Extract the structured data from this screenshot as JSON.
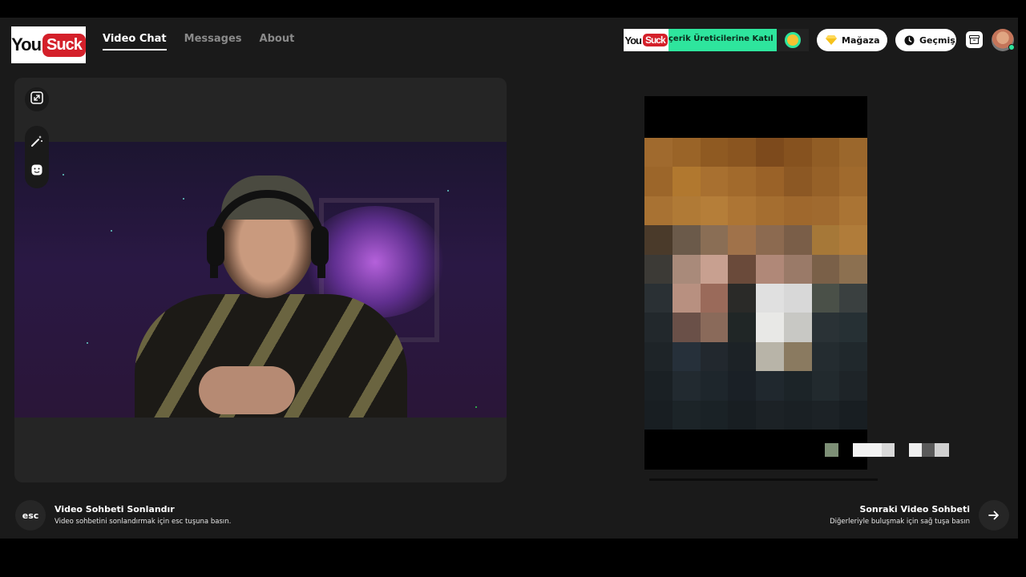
{
  "brand": {
    "logo_part1": "You",
    "logo_part2": "Suck",
    "accent": "#d4202a"
  },
  "nav": [
    {
      "label": "Video Chat",
      "active": true
    },
    {
      "label": "Messages",
      "active": false
    },
    {
      "label": "About",
      "active": false
    }
  ],
  "promo": {
    "text": "çerik Üreticilerine Katıl",
    "color": "#2ee59d"
  },
  "header_buttons": {
    "store_label": "Mağaza",
    "store_icon": "diamond-icon",
    "history_label": "Geçmiş",
    "history_icon": "clock-icon",
    "archive_icon": "archive-icon"
  },
  "video_tools": [
    "expand-icon",
    "magic-wand-icon",
    "face-filter-icon"
  ],
  "footer": {
    "esc_key": "esc",
    "end_title": "Video Sohbeti Sonlandır",
    "end_subtitle": "Video sohbetini sonlandırmak için esc tuşuna basın.",
    "next_title": "Sonraki Video Sohbeti",
    "next_subtitle": "Diğerleriyle buluşmak için sağ tuşa basın",
    "next_icon": "arrow-right-icon"
  },
  "colors": {
    "background": "#1a1a1a",
    "panel": "#252525",
    "online": "#2ee59d"
  }
}
